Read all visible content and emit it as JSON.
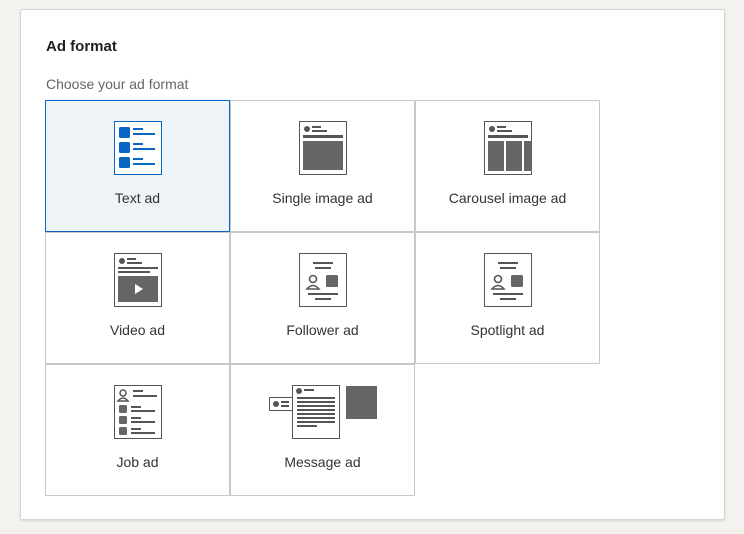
{
  "section": {
    "title": "Ad format",
    "subtitle": "Choose your ad format"
  },
  "formats": [
    {
      "label": "Text ad",
      "icon": "text-ad-icon",
      "selected": true
    },
    {
      "label": "Single image ad",
      "icon": "single-image-ad-icon",
      "selected": false
    },
    {
      "label": "Carousel image ad",
      "icon": "carousel-image-ad-icon",
      "selected": false
    },
    {
      "label": "Video ad",
      "icon": "video-ad-icon",
      "selected": false
    },
    {
      "label": "Follower ad",
      "icon": "follower-ad-icon",
      "selected": false
    },
    {
      "label": "Spotlight ad",
      "icon": "spotlight-ad-icon",
      "selected": false
    },
    {
      "label": "Job ad",
      "icon": "job-ad-icon",
      "selected": false
    },
    {
      "label": "Message ad",
      "icon": "message-ad-icon",
      "selected": false
    }
  ],
  "colors": {
    "accent": "#0a66c2",
    "selected_bg": "#eef3f8",
    "icon_dark": "#666666"
  }
}
